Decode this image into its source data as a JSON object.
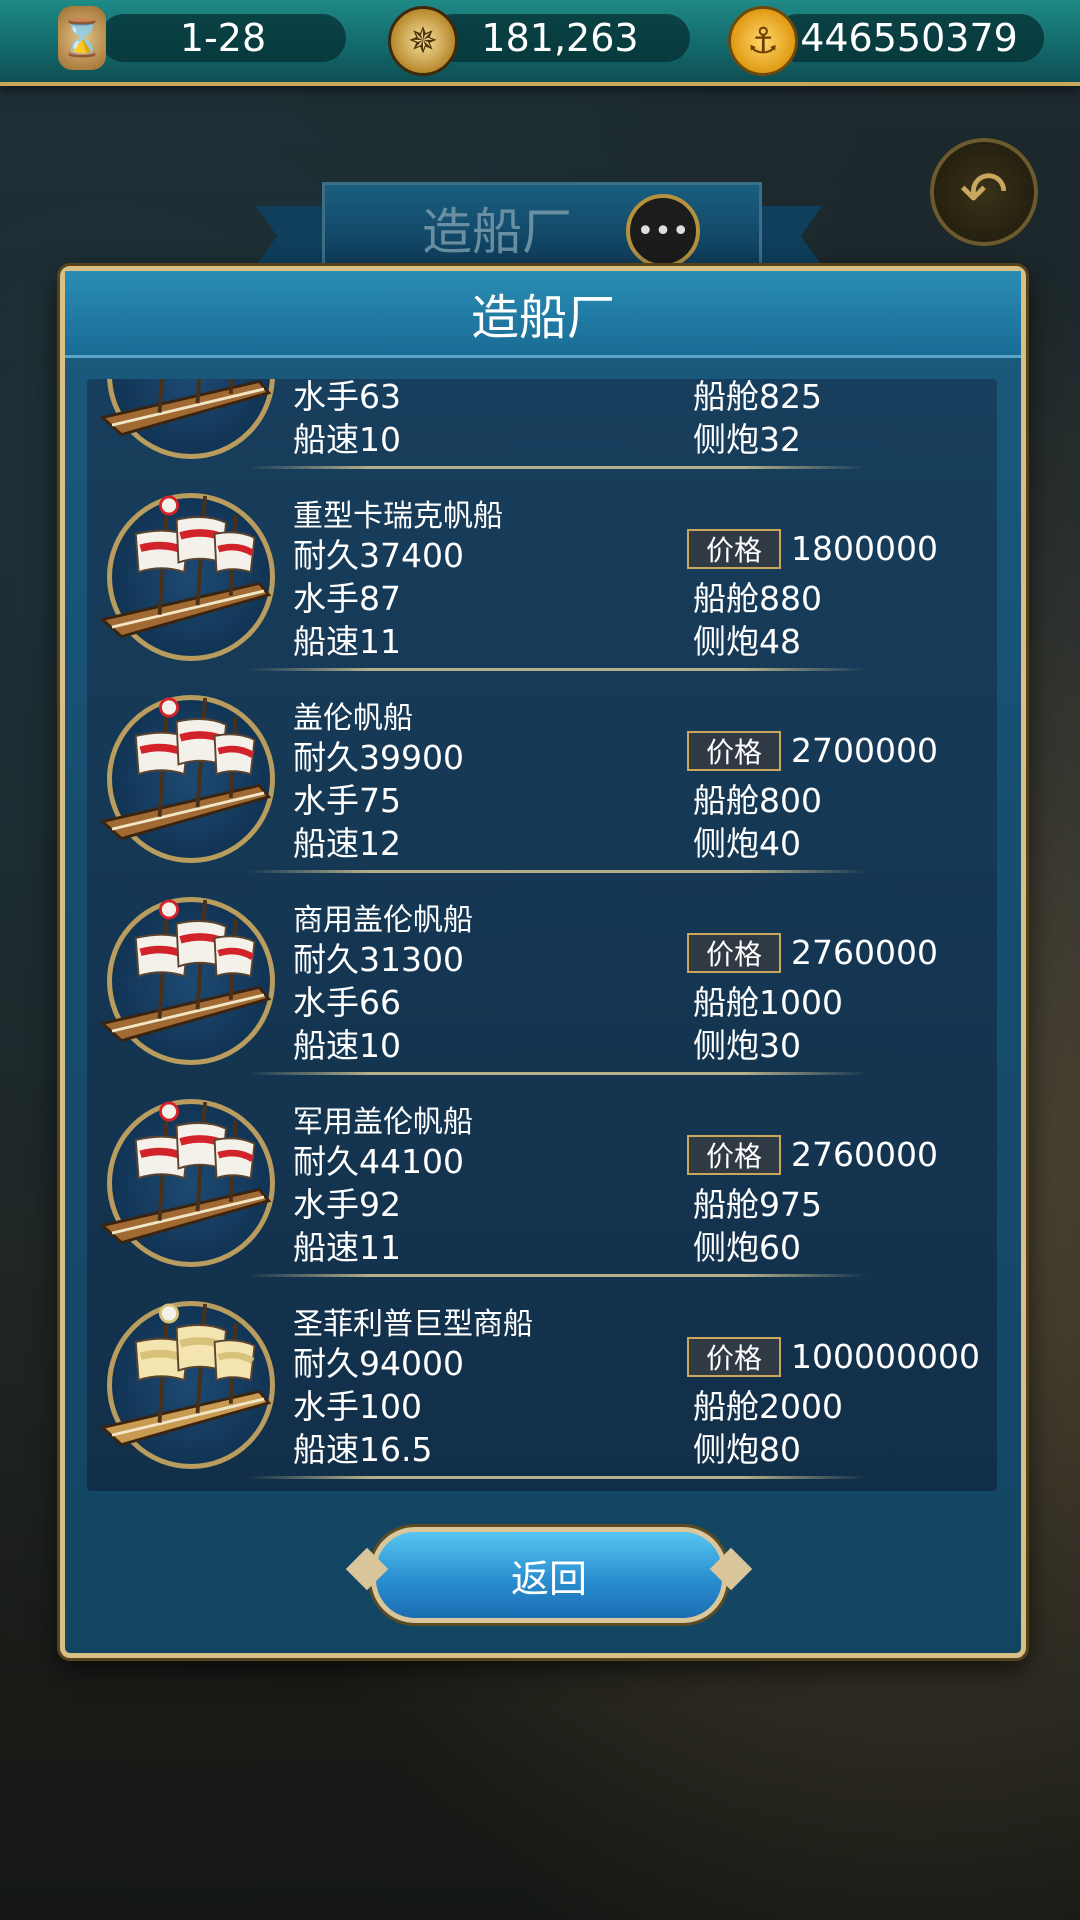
{
  "topbar": {
    "turn": "1-28",
    "fame": "181,263",
    "gold": "446550379"
  },
  "tab": {
    "title": "造船厂"
  },
  "panel": {
    "title": "造船厂",
    "return_label": "返回",
    "price_label": "价格"
  },
  "ships": [
    {
      "name": "",
      "durability": "",
      "crew": "水手63",
      "speed": "船速10",
      "price": "",
      "cabin": "船舱825",
      "cannon": "侧炮32",
      "type": "carrack"
    },
    {
      "name": "重型卡瑞克帆船",
      "durability": "耐久37400",
      "crew": "水手87",
      "speed": "船速11",
      "price": "1800000",
      "cabin": "船舱880",
      "cannon": "侧炮48",
      "type": "carrack"
    },
    {
      "name": "盖伦帆船",
      "durability": "耐久39900",
      "crew": "水手75",
      "speed": "船速12",
      "price": "2700000",
      "cabin": "船舱800",
      "cannon": "侧炮40",
      "type": "galleon"
    },
    {
      "name": "商用盖伦帆船",
      "durability": "耐久31300",
      "crew": "水手66",
      "speed": "船速10",
      "price": "2760000",
      "cabin": "船舱1000",
      "cannon": "侧炮30",
      "type": "galleon"
    },
    {
      "name": "军用盖伦帆船",
      "durability": "耐久44100",
      "crew": "水手92",
      "speed": "船速11",
      "price": "2760000",
      "cabin": "船舱975",
      "cannon": "侧炮60",
      "type": "galleon"
    },
    {
      "name": "圣菲利普巨型商船",
      "durability": "耐久94000",
      "crew": "水手100",
      "speed": "船速16.5",
      "price": "100000000",
      "cabin": "船舱2000",
      "cannon": "侧炮80",
      "type": "big-merchant"
    }
  ],
  "colors": {
    "accent_gold": "#c9a75c",
    "panel_blue": "#1b5a7e",
    "button_blue": "#2a8fd0"
  }
}
